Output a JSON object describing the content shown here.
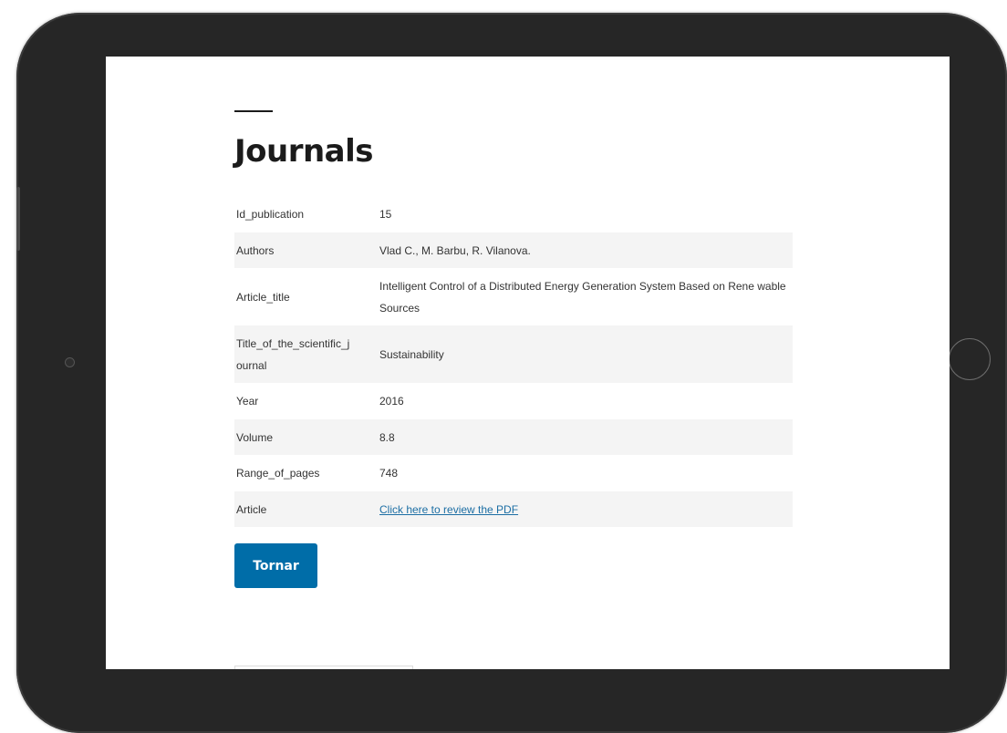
{
  "page": {
    "title": "Journals"
  },
  "details": [
    {
      "label": "Id_publication",
      "value": "15"
    },
    {
      "label": "Authors",
      "value": "Vlad C., M. Barbu, R. Vilanova."
    },
    {
      "label": "Article_title",
      "value": "Intelligent Control of a Distributed Energy Generation System Based on Rene wable Sources"
    },
    {
      "label": "Title_of_the_scientific_j ournal",
      "value": "Sustainability"
    },
    {
      "label": "Year",
      "value": "2016"
    },
    {
      "label": "Volume",
      "value": "8.8"
    },
    {
      "label": "Range_of_pages",
      "value": "748"
    },
    {
      "label": "Article",
      "value": "Click here to review the PDF"
    }
  ],
  "actions": {
    "back_label": "Tornar"
  },
  "colors": {
    "accent": "#006da8",
    "link": "#1c6ea4",
    "row_alt": "#f4f4f4",
    "device_frame": "#262626"
  }
}
